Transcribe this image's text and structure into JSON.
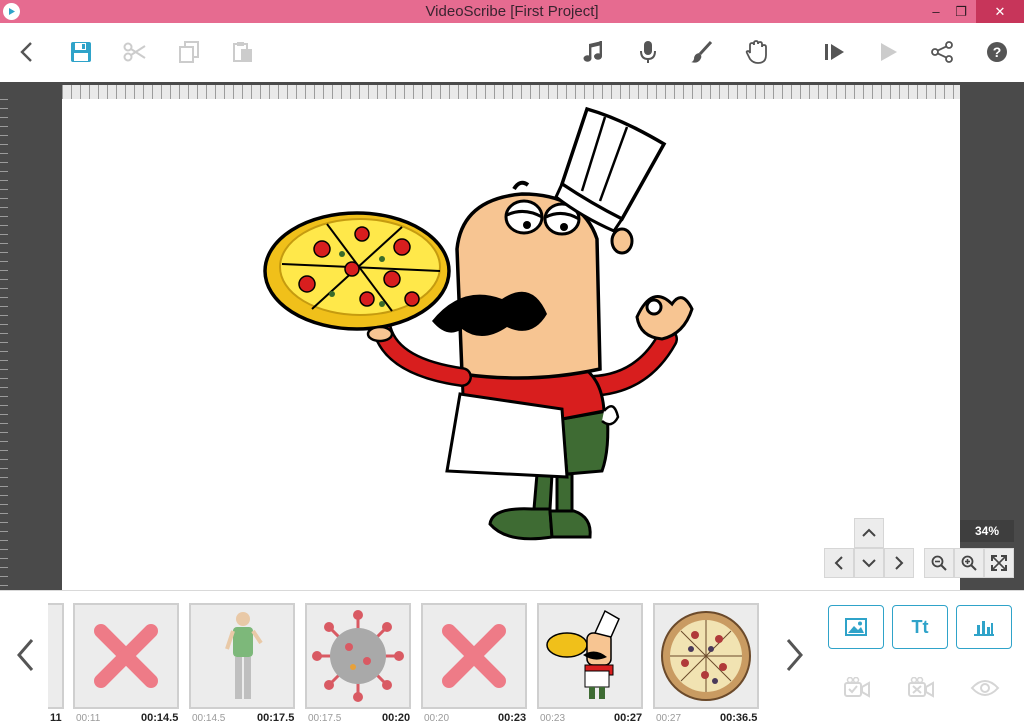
{
  "window": {
    "title": "VideoScribe [First Project]",
    "minimize": "–",
    "restore": "❐",
    "close": "✕"
  },
  "toolbar": {
    "icons": [
      "back-icon",
      "save-icon",
      "cut-icon",
      "copy-icon",
      "paste-icon",
      "music-icon",
      "microphone-icon",
      "brush-icon",
      "hand-icon",
      "play-from-icon",
      "play-icon",
      "share-icon",
      "help-icon"
    ]
  },
  "canvas": {
    "zoom_label": "34%"
  },
  "timeline": {
    "partial_label": "11",
    "elements": [
      {
        "kind": "missing",
        "start": "00:11",
        "end": "00:14.5"
      },
      {
        "kind": "man",
        "start": "00:14.5",
        "end": "00:17.5"
      },
      {
        "kind": "virus",
        "start": "00:17.5",
        "end": "00:20"
      },
      {
        "kind": "missing",
        "start": "00:20",
        "end": "00:23"
      },
      {
        "kind": "chef",
        "start": "00:23",
        "end": "00:27"
      },
      {
        "kind": "pizza",
        "start": "00:27",
        "end": "00:36.5"
      }
    ],
    "add_text_label": "Tt"
  },
  "colors": {
    "titlebar": "#e66b90",
    "accent": "#2fa3c9",
    "stage": "#4a4a4a",
    "missing_x": "#ee7b87"
  }
}
